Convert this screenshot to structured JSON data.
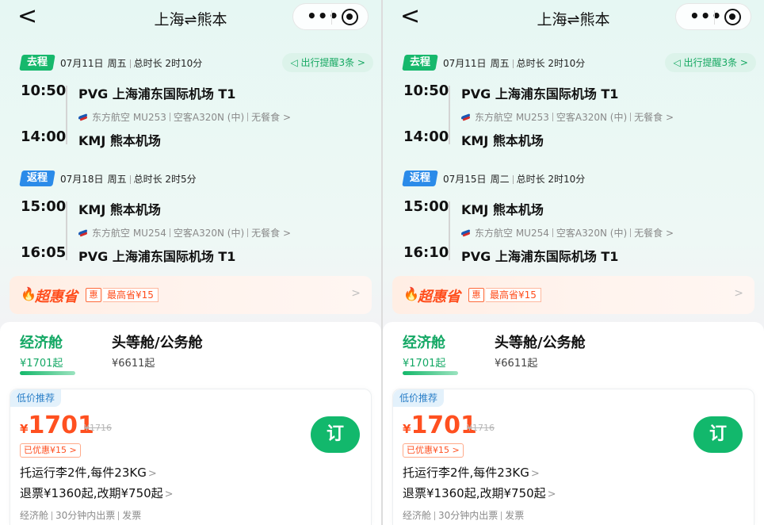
{
  "nav": {
    "title": "上海⇌熊本",
    "back": "<",
    "more": "•••"
  },
  "legs": {
    "left": {
      "outbound": {
        "tag": "去程",
        "date": "07月11日",
        "weekday": "周五",
        "duration": "总时长 2时10分",
        "reminder": "◁ 出行提醒3条 >",
        "dep_time": "10:50",
        "dep_airport": "PVG 上海浦东国际机场 T1",
        "airline": "东方航空 MU253",
        "aircraft": "空客A320N (中)",
        "meal": "无餐食 >",
        "arr_time": "14:00",
        "arr_airport": "KMJ 熊本机场"
      },
      "return": {
        "tag": "返程",
        "date": "07月18日",
        "weekday": "周五",
        "duration": "总时长 2时5分",
        "dep_time": "15:00",
        "dep_airport": "KMJ 熊本机场",
        "airline": "东方航空 MU254",
        "aircraft": "空客A320N (中)",
        "meal": "无餐食 >",
        "arr_time": "16:05",
        "arr_airport": "PVG 上海浦东国际机场 T1"
      }
    },
    "right": {
      "outbound": {
        "tag": "去程",
        "date": "07月11日",
        "weekday": "周五",
        "duration": "总时长 2时10分",
        "reminder": "◁ 出行提醒3条 >",
        "dep_time": "10:50",
        "dep_airport": "PVG 上海浦东国际机场 T1",
        "airline": "东方航空 MU253",
        "aircraft": "空客A320N (中)",
        "meal": "无餐食 >",
        "arr_time": "14:00",
        "arr_airport": "KMJ 熊本机场"
      },
      "return": {
        "tag": "返程",
        "date": "07月15日",
        "weekday": "周二",
        "duration": "总时长 2时10分",
        "dep_time": "15:00",
        "dep_airport": "KMJ 熊本机场",
        "airline": "东方航空 MU254",
        "aircraft": "空客A320N (中)",
        "meal": "无餐食 >",
        "arr_time": "16:10",
        "arr_airport": "PVG 上海浦东国际机场 T1"
      }
    }
  },
  "deal": {
    "icon": "🔥",
    "title": "超惠省",
    "badge": "惠",
    "text": "最高省¥15",
    "arrow": ">"
  },
  "cabins": {
    "economy": {
      "name": "经济舱",
      "price": "¥1701起"
    },
    "first": {
      "name": "头等舱/公务舱",
      "price": "¥6611起"
    }
  },
  "fare": {
    "tag": "低价推荐",
    "yen": "¥",
    "price": "1701",
    "original": "¥1716",
    "discount": "已优惠¥15 >",
    "book": "订",
    "baggage": "托运行李2件,每件23KG",
    "refund": "退票¥1360起,改期¥750起",
    "chev": ">",
    "footer": [
      "经济舱",
      "30分钟内出票",
      "发票"
    ]
  },
  "colors": {
    "accent": "#12b86c",
    "price": "#ff5020",
    "return_tag": "#2b8be9"
  }
}
